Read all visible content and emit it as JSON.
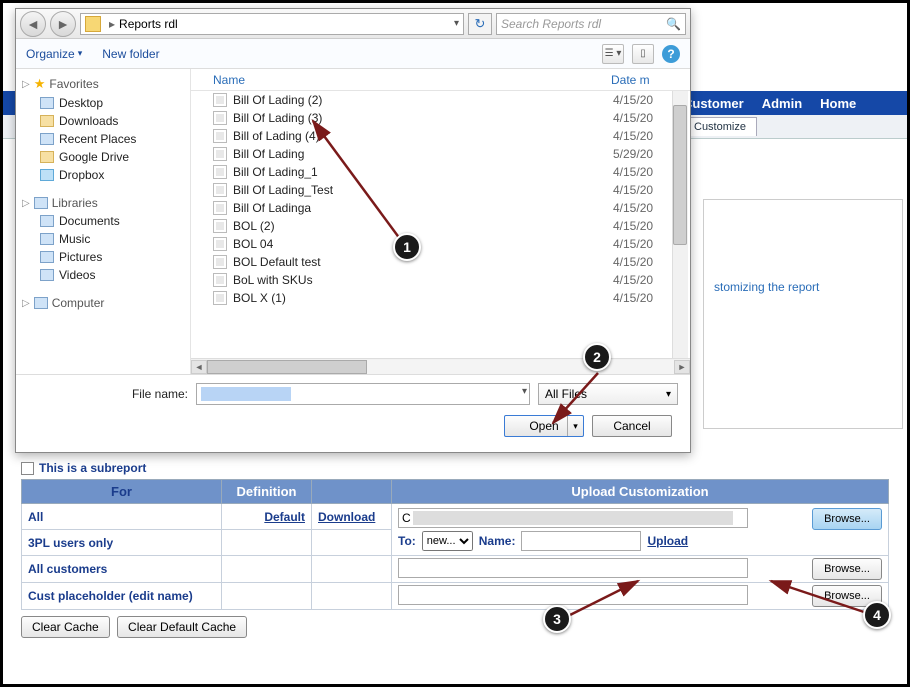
{
  "dialog": {
    "breadcrumb": "Reports rdl",
    "search_placeholder": "Search Reports rdl",
    "organize": "Organize",
    "newfolder": "New folder",
    "cols": {
      "name": "Name",
      "date": "Date m"
    },
    "nav": {
      "favorites": "Favorites",
      "desktop": "Desktop",
      "downloads": "Downloads",
      "recent": "Recent Places",
      "gdrive": "Google Drive",
      "dropbox": "Dropbox",
      "libraries": "Libraries",
      "documents": "Documents",
      "music": "Music",
      "pictures": "Pictures",
      "videos": "Videos",
      "computer": "Computer"
    },
    "files": [
      {
        "name": "Bill Of Lading (2)",
        "date": "4/15/20"
      },
      {
        "name": "Bill Of Lading (3)",
        "date": "4/15/20"
      },
      {
        "name": "Bill of Lading (4)",
        "date": "4/15/20"
      },
      {
        "name": "Bill Of Lading",
        "date": "5/29/20"
      },
      {
        "name": "Bill Of Lading_1",
        "date": "4/15/20"
      },
      {
        "name": "Bill Of Lading_Test",
        "date": "4/15/20"
      },
      {
        "name": "Bill Of Ladinga",
        "date": "4/15/20"
      },
      {
        "name": "BOL (2)",
        "date": "4/15/20"
      },
      {
        "name": "BOL 04",
        "date": "4/15/20"
      },
      {
        "name": "BOL Default test",
        "date": "4/15/20"
      },
      {
        "name": "BoL with SKUs",
        "date": "4/15/20"
      },
      {
        "name": "BOL X (1)",
        "date": "4/15/20"
      }
    ],
    "filename_label": "File name:",
    "filter": "All Files",
    "open": "Open",
    "cancel": "Cancel"
  },
  "app": {
    "menu": {
      "customer": "Customer",
      "admin": "Admin",
      "home": "Home"
    },
    "subtab": "Customize",
    "partial_text": "stomizing the report"
  },
  "lower": {
    "subreport": "This is a subreport",
    "headers": {
      "for": "For",
      "def": "Definition",
      "upload": "Upload Customization"
    },
    "rows": {
      "all": "All",
      "default": "Default",
      "download": "Download",
      "tpl": "3PL users only",
      "to": "To:",
      "to_opt": "new...",
      "name": "Name:",
      "upload": "Upload",
      "allcust": "All customers",
      "custph": "Cust placeholder (edit name)",
      "browse": "Browse...",
      "path_prefix": "C"
    },
    "clear": "Clear Cache",
    "cleardef": "Clear Default Cache"
  },
  "anno": {
    "1": "1",
    "2": "2",
    "3": "3",
    "4": "4"
  }
}
